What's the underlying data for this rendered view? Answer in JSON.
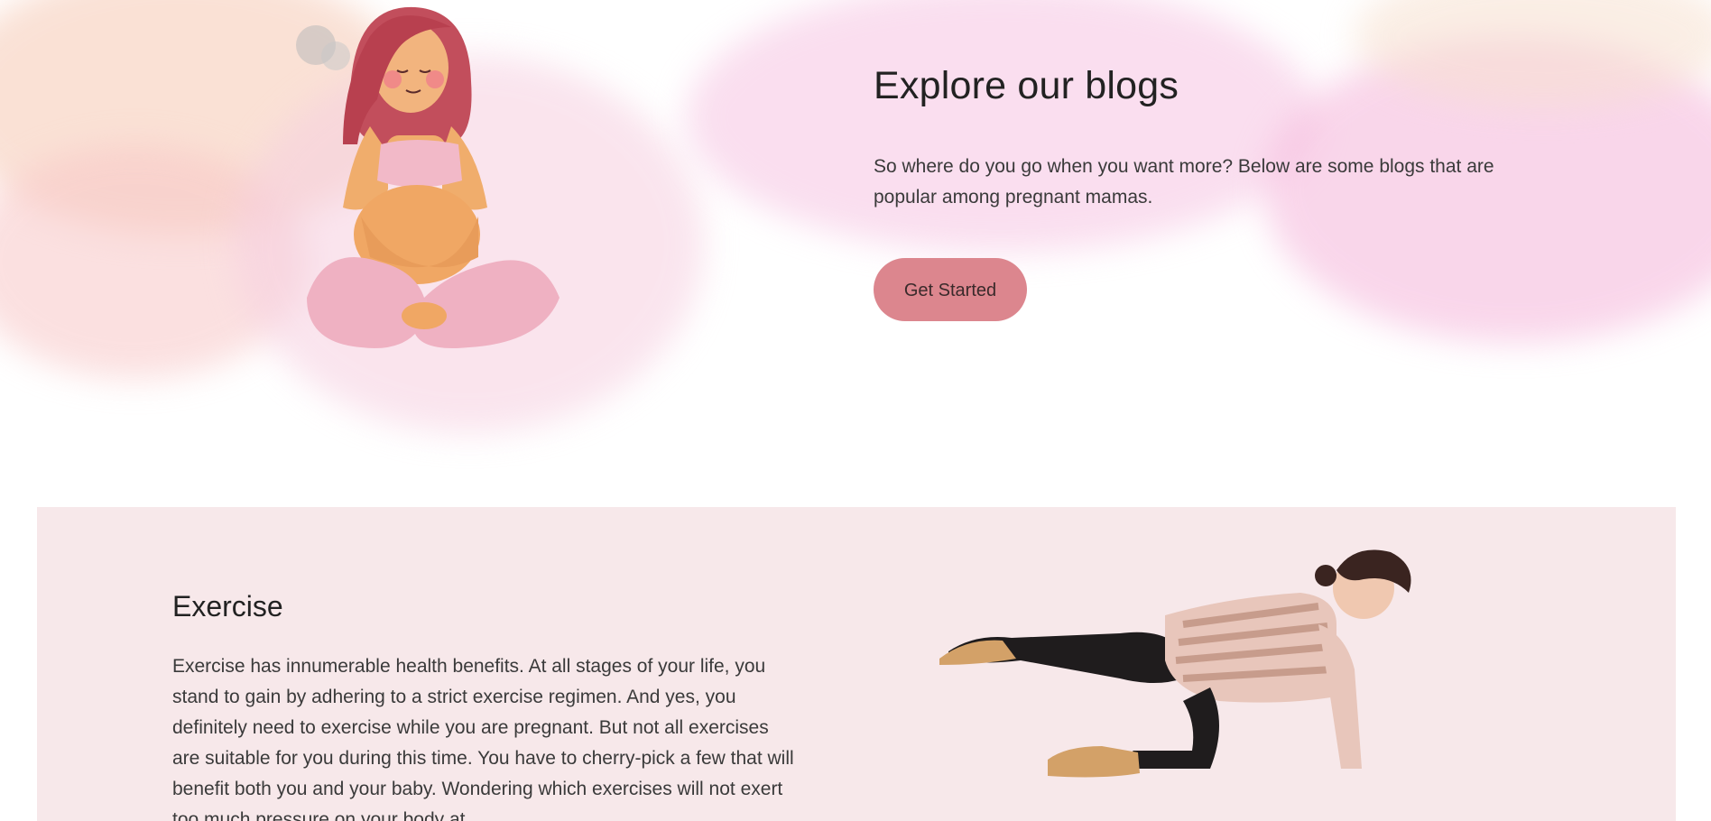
{
  "hero": {
    "title": "Explore our blogs",
    "description": "So where do you go when you want more? Below are some blogs that are popular among pregnant mamas.",
    "cta_label": "Get Started"
  },
  "exercise": {
    "title": "Exercise",
    "body": "Exercise has innumerable health benefits. At all stages of your life, you stand to gain by adhering to a strict exercise regimen. And yes, you definitely need to exercise while you are pregnant. But not all exercises are suitable for you during this time. You have to cherry-pick a few that will benefit both you and your baby. Wondering which exercises will not exert too much pressure on your body at"
  },
  "colors": {
    "accent": "#dc868e",
    "section_bg": "#f7e8ea",
    "watercolor_pink": "#f4b8d6",
    "watercolor_peach": "#f6c9b4"
  },
  "icons": {
    "hero_image": "pregnant-woman-illustration",
    "exercise_image": "pregnant-woman-exercise-photo"
  }
}
